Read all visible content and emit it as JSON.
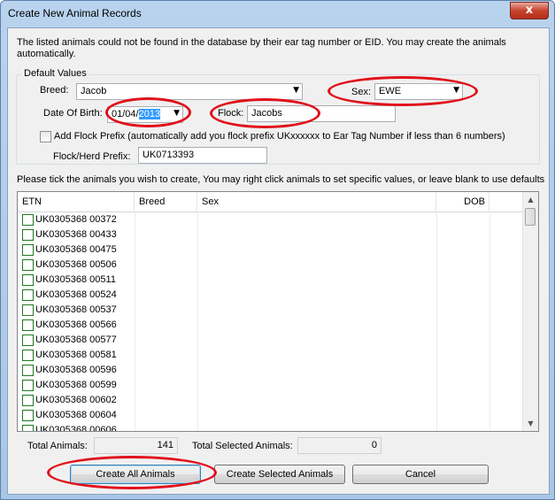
{
  "window": {
    "title": "Create  New Animal Records",
    "close_label": "x"
  },
  "intro_text": "The listed animals could not be found in the database by their ear tag number or EID. You may create the animals automatically.",
  "defaults": {
    "group_label": "Default Values",
    "breed_label": "Breed:",
    "breed_value": "Jacob",
    "sex_label": "Sex:",
    "sex_value": "EWE",
    "dob_label": "Date Of Birth:",
    "dob_day_month": "01/04/",
    "dob_year": "2013",
    "flock_label": "Flock:",
    "flock_value": "Jacobs",
    "add_prefix_label": "Add Flock Prefix (automatically add you flock prefix UKxxxxxx to Ear Tag Number if less than 6 numbers)",
    "flock_herd_prefix_label": "Flock/Herd Prefix:",
    "flock_herd_prefix_value": "UK0713393"
  },
  "instructions": "Please tick the animals you wish to create, You may right click animals to set specific values, or leave blank to use defaults",
  "table": {
    "columns": [
      "ETN",
      "Breed",
      "Sex",
      "DOB"
    ],
    "rows": [
      "UK0305368 00372",
      "UK0305368 00433",
      "UK0305368 00475",
      "UK0305368 00506",
      "UK0305368 00511",
      "UK0305368 00524",
      "UK0305368 00537",
      "UK0305368 00566",
      "UK0305368 00577",
      "UK0305368 00581",
      "UK0305368 00596",
      "UK0305368 00599",
      "UK0305368 00602",
      "UK0305368 00604",
      "UK0305368 00606"
    ]
  },
  "totals": {
    "total_animals_label": "Total Animals:",
    "total_animals_value": "141",
    "total_selected_label": "Total Selected Animals:",
    "total_selected_value": "0"
  },
  "buttons": {
    "create_all": "Create All Animals",
    "create_selected": "Create Selected Animals",
    "cancel": "Cancel"
  },
  "colors": {
    "annotation": "#e0101a",
    "selection": "#3399ff",
    "checkbox_border": "#1e7a1e"
  }
}
